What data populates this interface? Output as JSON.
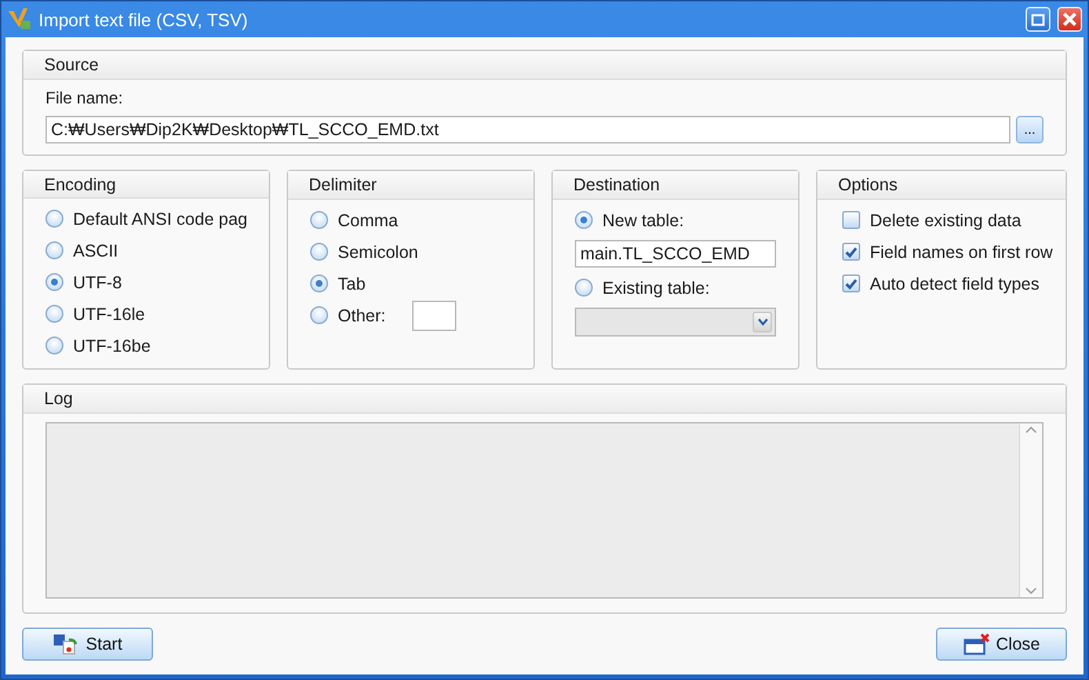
{
  "window": {
    "title": "Import text file (CSV, TSV)"
  },
  "source": {
    "heading": "Source",
    "label": "File name:",
    "value": "C:₩Users₩Dip2K₩Desktop₩TL_SCCO_EMD.txt",
    "browse": "..."
  },
  "encoding": {
    "heading": "Encoding",
    "options": [
      {
        "label": "Default ANSI code pag",
        "selected": false
      },
      {
        "label": "ASCII",
        "selected": false
      },
      {
        "label": "UTF-8",
        "selected": true
      },
      {
        "label": "UTF-16le",
        "selected": false
      },
      {
        "label": "UTF-16be",
        "selected": false
      }
    ]
  },
  "delimiter": {
    "heading": "Delimiter",
    "options": [
      {
        "label": "Comma",
        "selected": false,
        "kind": "plain"
      },
      {
        "label": "Semicolon",
        "selected": false,
        "kind": "plain"
      },
      {
        "label": "Tab",
        "selected": true,
        "kind": "plain"
      },
      {
        "label": "Other:",
        "selected": false,
        "kind": "other"
      }
    ]
  },
  "destination": {
    "heading": "Destination",
    "new_table": {
      "label": "New table:",
      "selected": true,
      "value": "main.TL_SCCO_EMD"
    },
    "existing_table": {
      "label": "Existing table:",
      "selected": false,
      "disabled": true
    }
  },
  "options": {
    "heading": "Options",
    "items": [
      {
        "label": "Delete existing data",
        "checked": false
      },
      {
        "label": "Field names on first row",
        "checked": true
      },
      {
        "label": "Auto detect field types",
        "checked": true
      }
    ]
  },
  "log": {
    "heading": "Log"
  },
  "buttons": {
    "start": "Start",
    "close": "Close"
  }
}
